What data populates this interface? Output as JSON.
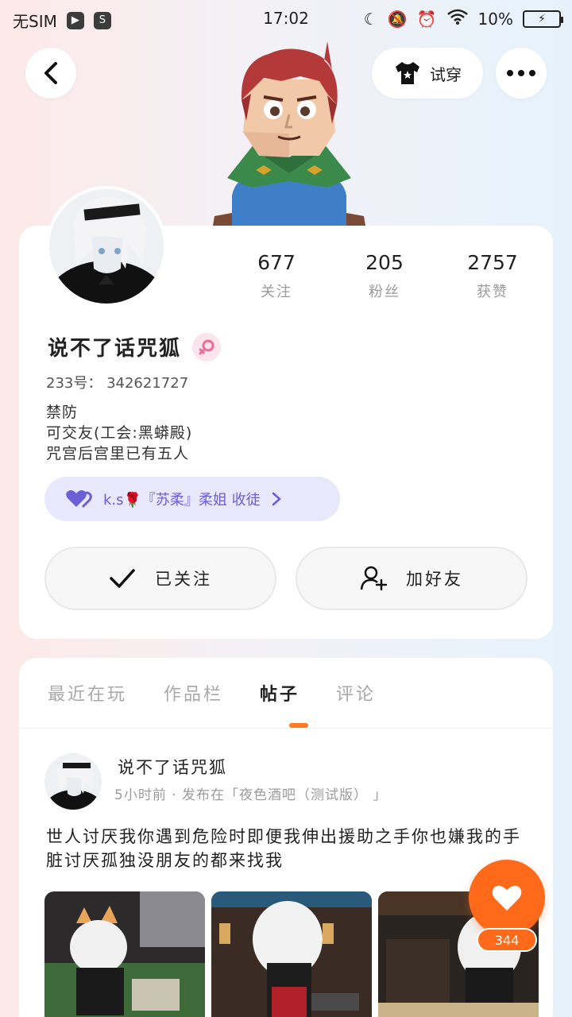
{
  "status_bar": {
    "carrier": "无SIM",
    "time": "17:02",
    "battery": "10%"
  },
  "header": {
    "tryon_label": "试穿"
  },
  "profile": {
    "stats": [
      {
        "value": "677",
        "label": "关注"
      },
      {
        "value": "205",
        "label": "粉丝"
      },
      {
        "value": "2757",
        "label": "获赞"
      }
    ],
    "username": "说不了话咒狐",
    "uid": "233号：  342621727",
    "bio": [
      "禁防",
      "可交友(工会:黑蟒殿)",
      "咒宫后宫里已有五人"
    ],
    "master_pill": "k.s🌹『苏柔』柔姐 收徒",
    "follow_label": "已关注",
    "add_friend_label": "加好友"
  },
  "tabs": [
    {
      "label": "最近在玩",
      "active": false
    },
    {
      "label": "作品栏",
      "active": false
    },
    {
      "label": "帖子",
      "active": true
    },
    {
      "label": "评论",
      "active": false
    }
  ],
  "post": {
    "author": "说不了话咒狐",
    "meta": "5小时前 · 发布在「夜色酒吧（测试版） 」",
    "text": "世人讨厌我你遇到危险时即便我伸出援助之手你也嫌我的手脏讨厌孤独没朋友的都来找我"
  },
  "like": {
    "count": "344"
  },
  "colors": {
    "accent": "#ff6a1a",
    "pill_bg": "#e9e7fb",
    "pill_text": "#6b5fd6"
  }
}
